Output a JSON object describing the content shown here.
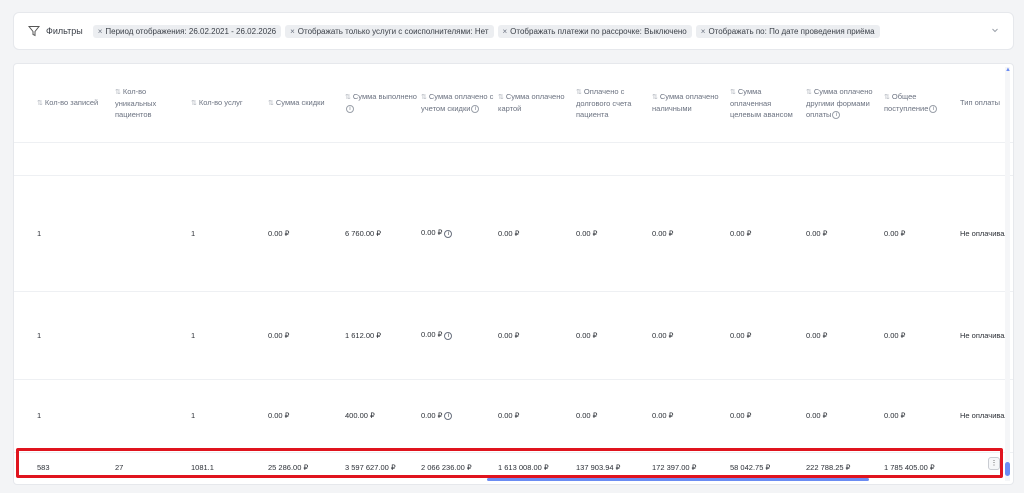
{
  "filters": {
    "title": "Фильтры",
    "chips": [
      "Период отображения: 26.02.2021 - 26.02.2026",
      "Отображать только услуги с соисполнителями: Нет",
      "Отображать платежи по рассрочке: Выключено",
      "Отображать по: По дате проведения приёма"
    ],
    "chip_close": "×",
    "collapse_icon": "chevron-down-icon"
  },
  "table": {
    "columns": [
      {
        "label": "Кол-во записей",
        "sort": true,
        "info": false
      },
      {
        "label": "Кол-во уникальных пациентов",
        "sort": true,
        "info": false
      },
      {
        "label": "Кол-во услуг",
        "sort": true,
        "info": false
      },
      {
        "label": "Сумма скидки",
        "sort": true,
        "info": false
      },
      {
        "label": "Сумма выполнено",
        "sort": true,
        "info": true
      },
      {
        "label": "Сумма оплачено с учетом скидки",
        "sort": true,
        "info": true
      },
      {
        "label": "Сумма оплачено картой",
        "sort": true,
        "info": false
      },
      {
        "label": "Оплачено с долгового счета пациента",
        "sort": true,
        "info": false
      },
      {
        "label": "Сумма оплачено наличными",
        "sort": true,
        "info": false
      },
      {
        "label": "Сумма оплаченная целевым авансом",
        "sort": true,
        "info": false
      },
      {
        "label": "Сумма оплачено другими формами оплаты",
        "sort": true,
        "info": true
      },
      {
        "label": "Общее поступление",
        "sort": true,
        "info": true
      },
      {
        "label": "Тип оплаты",
        "sort": false,
        "info": false
      }
    ],
    "rows": [
      [
        "1",
        "",
        "1",
        "0.00 ₽",
        "6 760.00 ₽",
        "0.00 ₽",
        "0.00 ₽",
        "0.00 ₽",
        "0.00 ₽",
        "0.00 ₽",
        "0.00 ₽",
        "0.00 ₽",
        "Не оплачивал"
      ],
      [
        "1",
        "",
        "1",
        "0.00 ₽",
        "1 612.00 ₽",
        "0.00 ₽",
        "0.00 ₽",
        "0.00 ₽",
        "0.00 ₽",
        "0.00 ₽",
        "0.00 ₽",
        "0.00 ₽",
        "Не оплачивал"
      ],
      [
        "1",
        "",
        "1",
        "0.00 ₽",
        "400.00 ₽",
        "0.00 ₽",
        "0.00 ₽",
        "0.00 ₽",
        "0.00 ₽",
        "0.00 ₽",
        "0.00 ₽",
        "0.00 ₽",
        "Не оплачивал"
      ]
    ],
    "total": [
      "583",
      "27",
      "1081.1",
      "25 286.00 ₽",
      "3 597 627.00 ₽",
      "2 066 236.00 ₽",
      "1 613 008.00 ₽",
      "137 903.94 ₽",
      "172 397.00 ₽",
      "58 042.75 ₽",
      "222 788.25 ₽",
      "1 785 405.00 ₽",
      ""
    ]
  },
  "colors": {
    "highlight": "#e0141e",
    "scroll": "#6b8cf2"
  }
}
